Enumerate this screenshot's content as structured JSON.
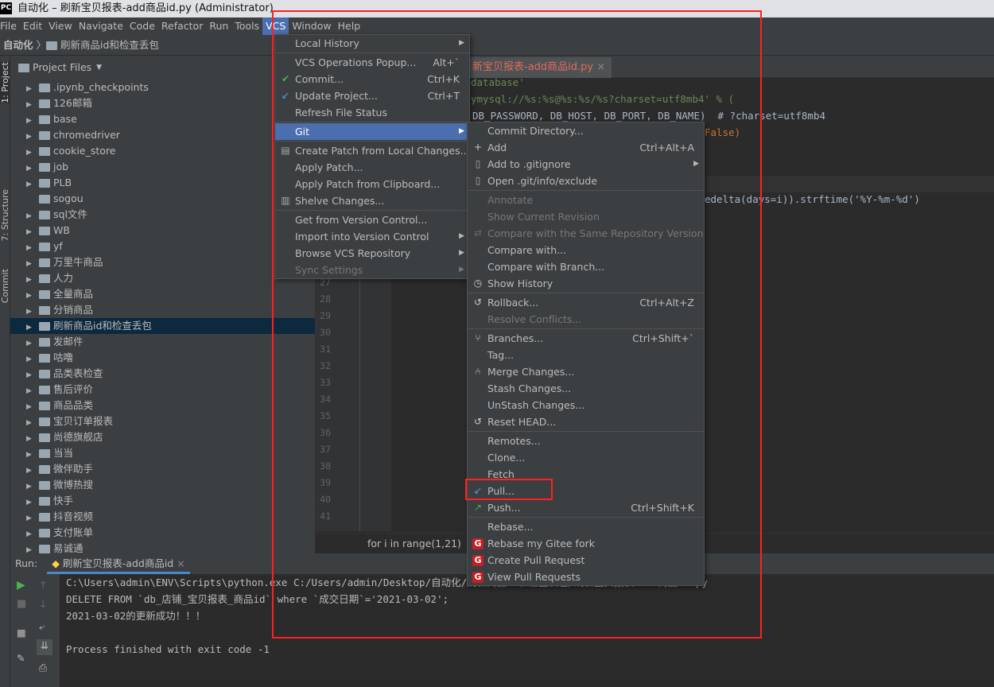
{
  "window": {
    "title": "自动化 – 刷新宝贝报表-add商品id.py (Administrator)",
    "logo": "PC"
  },
  "menubar": [
    "File",
    "Edit",
    "View",
    "Navigate",
    "Code",
    "Refactor",
    "Run",
    "Tools",
    "VCS",
    "Window",
    "Help"
  ],
  "navbar": {
    "root": "自动化",
    "folder": "刷新商品id和检查丢包"
  },
  "side_tabs": [
    "1: Project",
    "7: Structure",
    "Commit"
  ],
  "project": {
    "title": "Project Files",
    "items": [
      {
        "label": ".ipynb_checkpoints",
        "arrow": true
      },
      {
        "label": "126邮箱",
        "arrow": true
      },
      {
        "label": "base",
        "arrow": true
      },
      {
        "label": "chromedriver",
        "arrow": true
      },
      {
        "label": "cookie_store",
        "arrow": true
      },
      {
        "label": "job",
        "arrow": true
      },
      {
        "label": "PLB",
        "arrow": true
      },
      {
        "label": "sogou",
        "arrow": false
      },
      {
        "label": "sql文件",
        "arrow": true
      },
      {
        "label": "WB",
        "arrow": true
      },
      {
        "label": "yf",
        "arrow": true
      },
      {
        "label": "万里牛商品",
        "arrow": true
      },
      {
        "label": "人力",
        "arrow": true
      },
      {
        "label": "全量商品",
        "arrow": true
      },
      {
        "label": "分销商品",
        "arrow": true
      },
      {
        "label": "刷新商品id和检查丢包",
        "arrow": true,
        "selected": true
      },
      {
        "label": "发邮件",
        "arrow": true
      },
      {
        "label": "咕噜",
        "arrow": true
      },
      {
        "label": "品类表检查",
        "arrow": true
      },
      {
        "label": "售后评价",
        "arrow": true
      },
      {
        "label": "商品品类",
        "arrow": true
      },
      {
        "label": "宝贝订单报表",
        "arrow": true
      },
      {
        "label": "尚德旗舰店",
        "arrow": true
      },
      {
        "label": "当当",
        "arrow": true
      },
      {
        "label": "微伴助手",
        "arrow": true
      },
      {
        "label": "微博热搜",
        "arrow": true
      },
      {
        "label": "快手",
        "arrow": true
      },
      {
        "label": "抖音视频",
        "arrow": true
      },
      {
        "label": "支付账单",
        "arrow": true
      },
      {
        "label": "易诚通",
        "arrow": true
      }
    ]
  },
  "editor": {
    "tab": "新宝贝报表-add商品id.py",
    "line_numbers": [
      "27",
      "28",
      "29",
      "30",
      "31",
      "32",
      "33",
      "34",
      "35",
      "36",
      "37",
      "38",
      "39",
      "40",
      "41"
    ],
    "code": [
      "database'",
      "ymysql://%s:%s@%s:%s/%s?charset=utf8mb4' % (",
      "DB_PASSWORD, DB_HOST, DB_PORT, DB_NAME)  # ?charset=utf8mb4",
      "False)",
      "edelta(days=i)).strftime('%Y-%m-%d')"
    ],
    "breadcrumb": "for i in range(1,21)"
  },
  "run": {
    "label": "Run:",
    "tab": "刷新宝贝报表-add商品id",
    "console": [
      "C:\\Users\\admin\\ENV\\Scripts\\python.exe C:/Users/admin/Desktop/自动化/刷新商品id和检查丢包/刷新宝贝报表-add商品id.py",
      "DELETE FROM `db_店铺_宝贝报表_商品id` where `成交日期`='2021-03-02';",
      "2021-03-02的更新成功！！！",
      "",
      "Process finished with exit code -1"
    ]
  },
  "vcs_menu": [
    {
      "label": "Local History",
      "sub": true
    },
    {
      "sep": true
    },
    {
      "label": "VCS Operations Popup...",
      "shortcut": "Alt+`"
    },
    {
      "label": "Commit...",
      "shortcut": "Ctrl+K",
      "icon": "check"
    },
    {
      "label": "Update Project...",
      "shortcut": "Ctrl+T",
      "icon": "update"
    },
    {
      "label": "Refresh File Status"
    },
    {
      "sep": true
    },
    {
      "label": "Git",
      "sub": true,
      "selected": true
    },
    {
      "sep": true
    },
    {
      "label": "Create Patch from Local Changes...",
      "icon": "patch"
    },
    {
      "label": "Apply Patch..."
    },
    {
      "label": "Apply Patch from Clipboard..."
    },
    {
      "label": "Shelve Changes...",
      "icon": "shelve"
    },
    {
      "sep": true
    },
    {
      "label": "Get from Version Control..."
    },
    {
      "label": "Import into Version Control",
      "sub": true
    },
    {
      "label": "Browse VCS Repository",
      "sub": true
    },
    {
      "label": "Sync Settings",
      "sub": true,
      "disabled": true
    }
  ],
  "git_menu": [
    {
      "label": "Commit Directory..."
    },
    {
      "label": "Add",
      "shortcut": "Ctrl+Alt+A",
      "icon": "plus"
    },
    {
      "label": "Add to .gitignore",
      "sub": true,
      "icon": "file"
    },
    {
      "label": "Open .git/info/exclude",
      "icon": "file"
    },
    {
      "sep": true
    },
    {
      "label": "Annotate",
      "disabled": true
    },
    {
      "label": "Show Current Revision",
      "disabled": true
    },
    {
      "label": "Compare with the Same Repository Version",
      "disabled": true,
      "icon": "compare"
    },
    {
      "label": "Compare with..."
    },
    {
      "label": "Compare with Branch..."
    },
    {
      "label": "Show History",
      "icon": "clock"
    },
    {
      "sep": true
    },
    {
      "label": "Rollback...",
      "shortcut": "Ctrl+Alt+Z",
      "icon": "rollback"
    },
    {
      "label": "Resolve Conflicts...",
      "disabled": true
    },
    {
      "sep": true
    },
    {
      "label": "Branches...",
      "shortcut": "Ctrl+Shift+`",
      "icon": "branch"
    },
    {
      "label": "Tag..."
    },
    {
      "label": "Merge Changes...",
      "icon": "merge"
    },
    {
      "label": "Stash Changes..."
    },
    {
      "label": "UnStash Changes..."
    },
    {
      "label": "Reset HEAD...",
      "icon": "rollback"
    },
    {
      "sep": true
    },
    {
      "label": "Remotes..."
    },
    {
      "label": "Clone..."
    },
    {
      "label": "Fetch"
    },
    {
      "label": "Pull...",
      "icon": "pull"
    },
    {
      "label": "Push...",
      "shortcut": "Ctrl+Shift+K",
      "icon": "push"
    },
    {
      "sep": true
    },
    {
      "label": "Rebase..."
    },
    {
      "label": "Rebase my Gitee fork",
      "icon": "gitee"
    },
    {
      "label": "Create Pull Request",
      "icon": "gitee"
    },
    {
      "label": "View Pull Requests",
      "icon": "gitee"
    }
  ],
  "colors": {
    "accent": "#4b6eaf",
    "highlight": "#ff2020",
    "gitee": "#c71d23"
  }
}
